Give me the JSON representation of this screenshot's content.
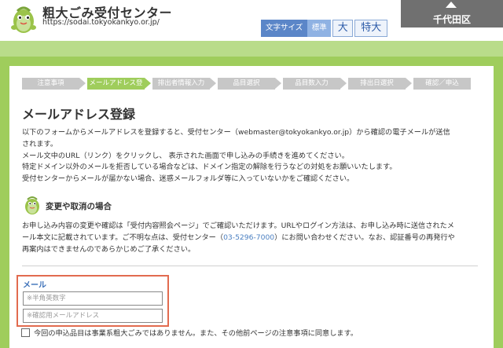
{
  "header": {
    "site_title": "粗大ごみ受付センター",
    "site_url": "https://sodai.tokyokankyo.or.jp/",
    "font_size": {
      "label": "文字サイズ",
      "standard": "標準",
      "large": "大",
      "xlarge": "特大"
    },
    "district": "千代田区"
  },
  "steps": [
    {
      "label": "注意事項",
      "active": false
    },
    {
      "label": "メールアドレス登録",
      "active": true
    },
    {
      "label": "排出者情報入力",
      "active": false
    },
    {
      "label": "品目選択",
      "active": false
    },
    {
      "label": "品目数入力",
      "active": false
    },
    {
      "label": "排出日選択",
      "active": false
    },
    {
      "label": "確認／申込",
      "active": false
    }
  ],
  "page_title": "メールアドレス登録",
  "intro": {
    "line1": "以下のフォームからメールアドレスを登録すると、受付センター（webmaster@tokyokankyo.or.jp）から確認の電子メールが送信",
    "line2": "されます。",
    "line3": "メール文中のURL（リンク）をクリックし、 表示された画面で申し込みの手続きを進めてください。",
    "line4": "特定ドメイン以外のメールを拒否している場合などは、ドメイン指定の解除を行うなどの対処をお願いいたします。",
    "line5": "受付センターからメールが届かない場合、迷惑メールフォルダ等に入っていないかをご確認ください。"
  },
  "section": {
    "title": "変更や取消の場合"
  },
  "notice": {
    "line1": "お申し込み内容の変更や確認は「受付内容照会ページ」でご確認いただけます。URLやログイン方法は、お申し込み時に送信されたメ",
    "line2": "ール本文に記載されています。ご不明な点は、受付センター（",
    "tel": "03-5296-7000",
    "line2b": "）にお問い合わせください。なお、認証番号の再発行や",
    "line3": "再案内はできませんのであらかじめご了承ください。"
  },
  "form": {
    "mail_label": "メール",
    "mail_placeholder": "※半角英数字",
    "confirm_placeholder": "※確認用メールアドレス",
    "agree_text": "今回の申込品目は事業系粗大ごみではありません。また、その他前ページの注意事項に同意します。"
  },
  "colors": {
    "accent_green": "#9fcd5c",
    "step_gray": "#c7c7c7",
    "link_blue": "#4a7fc1",
    "highlight_red": "#e26b4f"
  }
}
